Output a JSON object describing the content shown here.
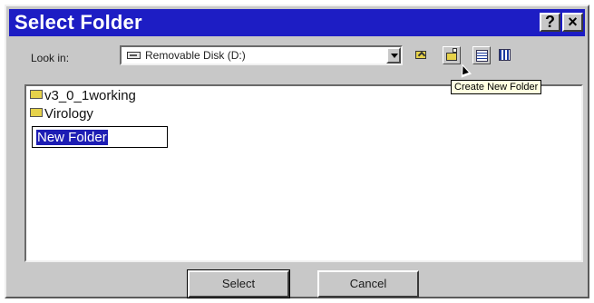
{
  "dialog": {
    "title": "Select Folder",
    "help_button": "?",
    "close_button": "×"
  },
  "lookin": {
    "label": "Look in:",
    "value": "Removable Disk (D:)",
    "drive_icon": "removable-disk-icon"
  },
  "toolbar": {
    "up_one_level": "folder-up-icon",
    "create_new_folder": "new-folder-icon",
    "list_view": "list-view-icon",
    "details_view": "details-view-icon"
  },
  "tooltip": "Create New Folder",
  "folders": [
    {
      "name": "v3_0_1working"
    },
    {
      "name": "Virology"
    }
  ],
  "new_folder": {
    "value": "New Folder"
  },
  "buttons": {
    "select": "Select",
    "cancel": "Cancel"
  },
  "colors": {
    "titlebar": "#1d1dc4",
    "dialog_bg": "#c8c8c8",
    "selection": "#1d1db4",
    "tooltip_bg": "#ffffe1"
  }
}
